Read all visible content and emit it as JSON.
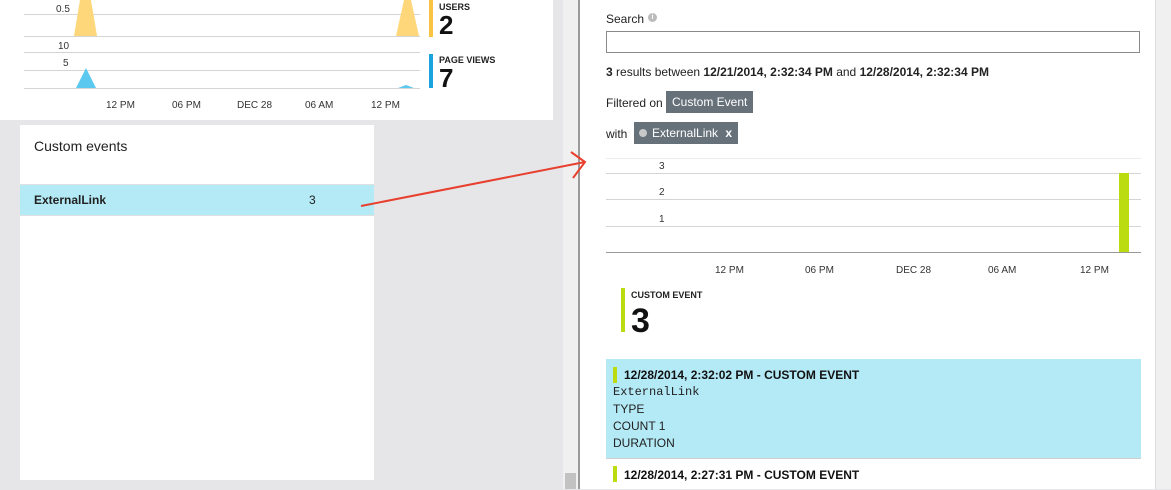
{
  "top_chart": {
    "y_labels": [
      "0.5",
      "10",
      "5"
    ],
    "x_labels": [
      "12 PM",
      "06 PM",
      "DEC 28",
      "06 AM",
      "12 PM"
    ],
    "colors": {
      "users": "#f8c441",
      "users_fill": "#fdd77a",
      "page_views": "#1aa4de",
      "page_views_fill": "#5bc8ef"
    }
  },
  "metrics": {
    "users": {
      "title": "USERS",
      "value": "2"
    },
    "page_views": {
      "title": "PAGE VIEWS",
      "value": "7"
    }
  },
  "custom_events": {
    "title": "Custom events",
    "rows": [
      {
        "name": "ExternalLink",
        "count": "3"
      }
    ]
  },
  "search": {
    "label": "Search",
    "info_icon": "info-icon",
    "input_value": "",
    "results_count": "3",
    "results_text": "results between",
    "start": "12/21/2014, 2:32:34 PM",
    "and_text": "and",
    "end": "12/28/2014, 2:32:34 PM"
  },
  "filters": {
    "filtered_on_label": "Filtered on",
    "filtered_on_chip": "Custom Event",
    "with_label": "with",
    "with_chip": "ExternalLink",
    "with_chip_close": "x"
  },
  "right_chart": {
    "y_labels": [
      "3",
      "2",
      "1"
    ],
    "x_labels": [
      "12 PM",
      "06 PM",
      "DEC 28",
      "06 AM",
      "12 PM"
    ],
    "bar_color": "#badc10"
  },
  "custom_event_metric": {
    "title": "CUSTOM EVENT",
    "value": "3"
  },
  "results": [
    {
      "title": "12/28/2014, 2:32:02 PM - CUSTOM EVENT",
      "name": "ExternalLink",
      "type": "TYPE",
      "count": "COUNT 1",
      "duration": "DURATION"
    },
    {
      "title": "12/28/2014, 2:27:31 PM - CUSTOM EVENT"
    }
  ],
  "annotation_arrow_color": "#e8402f"
}
